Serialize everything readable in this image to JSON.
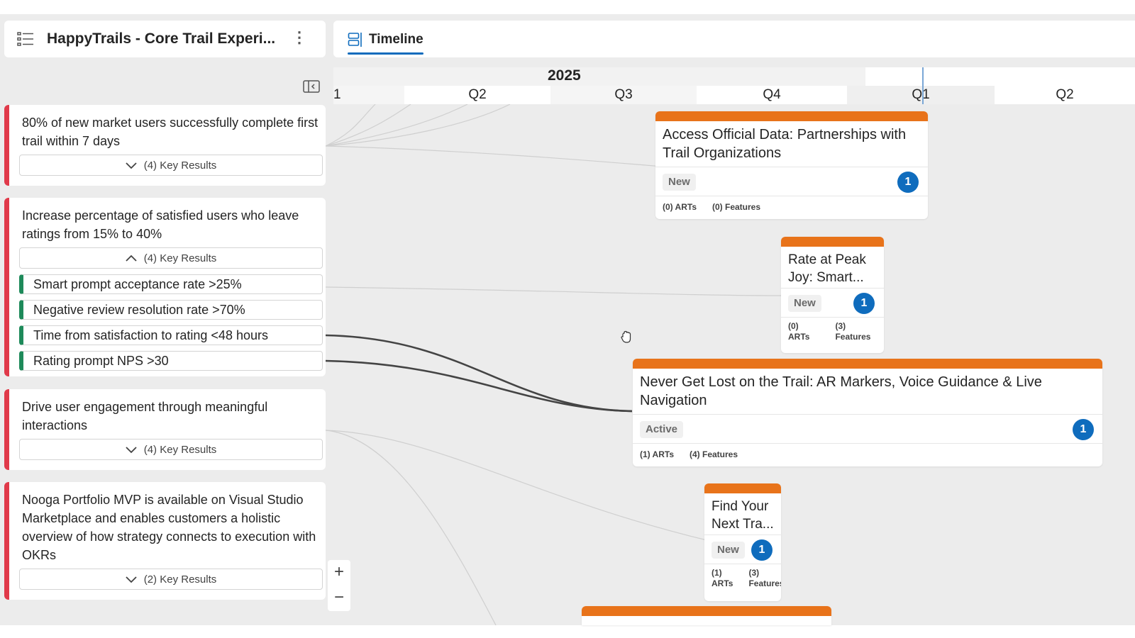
{
  "header": {
    "title": "HappyTrails - Core Trail Experi...",
    "menu_icon": "list-icon",
    "more_icon": "more-vertical-icon",
    "more_glyph": "⋮"
  },
  "tabs": [
    {
      "label": "Timeline",
      "icon": "timeline-icon",
      "active": true
    }
  ],
  "objectives": [
    {
      "title": "80% of new market users successfully complete first trail within 7 days",
      "kr_label": "(4) Key Results",
      "expanded": false
    },
    {
      "title": "Increase percentage of satisfied users who leave ratings from 15% to 40%",
      "kr_label": "(4) Key Results",
      "expanded": true,
      "key_results": [
        "Smart prompt acceptance rate >25%",
        "Negative review resolution rate >70%",
        "Time from satisfaction to rating <48 hours",
        "Rating prompt NPS >30"
      ]
    },
    {
      "title": "Drive user engagement through meaningful interactions",
      "kr_label": "(4) Key Results",
      "expanded": false
    },
    {
      "title": "Nooga Portfolio MVP is available on Visual Studio Marketplace and enables customers a holistic overview of how strategy connects to execution with OKRs",
      "kr_label": "(2) Key Results",
      "expanded": false
    }
  ],
  "timeline": {
    "year": "2025",
    "quarters": [
      "1",
      "Q2",
      "Q3",
      "Q4",
      "Q1",
      "Q2"
    ]
  },
  "epics": [
    {
      "title": "Access Official Data: Partnerships with Trail Organizations",
      "status": "New",
      "count": "1",
      "arts": "(0) ARTs",
      "features": "(0) Features"
    },
    {
      "title": "Rate at Peak Joy: Smart...",
      "status": "New",
      "count": "1",
      "arts_num": "(0)",
      "arts_word": "ARTs",
      "features_num": "(3)",
      "features_word": "Features"
    },
    {
      "title": "Never Get Lost on the Trail: AR Markers, Voice Guidance & Live Navigation",
      "status": "Active",
      "count": "1",
      "arts": "(1) ARTs",
      "features": "(4) Features"
    },
    {
      "title": "Find Your Next Tra...",
      "status": "New",
      "count": "1",
      "arts_num": "(1)",
      "arts_word": "ARTs",
      "features_num": "(3)",
      "features_word": "Features"
    }
  ],
  "zoom": {
    "in": "+",
    "out": "−"
  },
  "colors": {
    "accent": "#0f6cbd",
    "objective": "#e03a4a",
    "key_result": "#1e8a5a",
    "epic_bar": "#e8731a"
  }
}
